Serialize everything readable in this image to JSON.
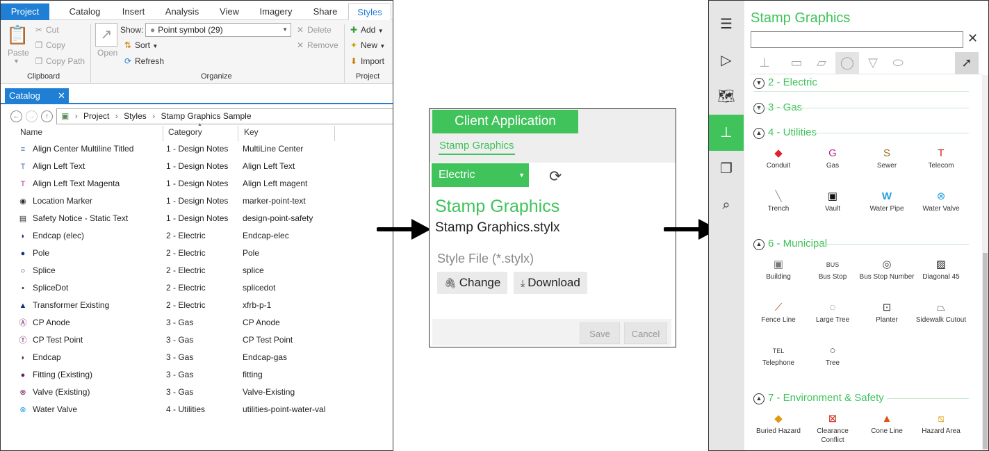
{
  "ribbon": {
    "tabs": [
      "Project",
      "Catalog",
      "Insert",
      "Analysis",
      "View",
      "Imagery",
      "Share",
      "Styles"
    ],
    "clipboard": {
      "paste": "Paste",
      "cut": "Cut",
      "copy": "Copy",
      "copy_path": "Copy Path",
      "label": "Clipboard"
    },
    "organize": {
      "open": "Open",
      "show_label": "Show:",
      "show_value": "Point symbol (29)",
      "sort": "Sort",
      "refresh": "Refresh",
      "delete": "Delete",
      "remove": "Remove",
      "label": "Organize"
    },
    "project": {
      "add": "Add",
      "new": "New",
      "import": "Import",
      "label": "Project"
    }
  },
  "catalog": {
    "tab_label": "Catalog",
    "breadcrumb": [
      "Project",
      "Styles",
      "Stamp Graphics Sample"
    ],
    "columns": [
      "Name",
      "Category",
      "Key"
    ],
    "rows": [
      {
        "icon": "multiline-text-icon",
        "name": "Align Center Multiline Titled",
        "category": "1 - Design Notes",
        "key": "MultiLine Center"
      },
      {
        "icon": "text-icon",
        "name": "Align Left Text",
        "category": "1 - Design Notes",
        "key": "Align Left Text"
      },
      {
        "icon": "text-magenta-icon",
        "name": "Align Left Text Magenta",
        "category": "1 - Design Notes",
        "key": "Align Left magent"
      },
      {
        "icon": "location-marker-icon",
        "name": "Location Marker",
        "category": "1 - Design Notes",
        "key": "marker-point-text"
      },
      {
        "icon": "safety-notice-icon",
        "name": "Safety Notice - Static Text",
        "category": "1 - Design Notes",
        "key": "design-point-safety"
      },
      {
        "icon": "endcap-icon",
        "name": "Endcap (elec)",
        "category": "2 - Electric",
        "key": "Endcap-elec"
      },
      {
        "icon": "pole-icon",
        "name": "Pole",
        "category": "2 - Electric",
        "key": "Pole"
      },
      {
        "icon": "splice-icon",
        "name": "Splice",
        "category": "2 - Electric",
        "key": "splice"
      },
      {
        "icon": "splicedot-icon",
        "name": "SpliceDot",
        "category": "2 - Electric",
        "key": "splicedot"
      },
      {
        "icon": "transformer-icon",
        "name": "Transformer Existing",
        "category": "2 - Electric",
        "key": "xfrb-p-1"
      },
      {
        "icon": "cp-anode-icon",
        "name": "CP Anode",
        "category": "3 - Gas",
        "key": "CP Anode"
      },
      {
        "icon": "cp-test-point-icon",
        "name": "CP Test Point",
        "category": "3 - Gas",
        "key": "CP Test Point"
      },
      {
        "icon": "endcap-gas-icon",
        "name": "Endcap",
        "category": "3 - Gas",
        "key": "Endcap-gas"
      },
      {
        "icon": "fitting-icon",
        "name": "Fitting (Existing)",
        "category": "3 - Gas",
        "key": "fitting"
      },
      {
        "icon": "valve-icon",
        "name": "Valve (Existing)",
        "category": "3 - Gas",
        "key": "Valve-Existing"
      },
      {
        "icon": "water-valve-icon",
        "name": "Water Valve",
        "category": "4 - Utilities",
        "key": "utilities-point-water-val"
      }
    ]
  },
  "client": {
    "header_button": "Client Application",
    "tab": "Stamp Graphics",
    "dropdown_value": "Electric",
    "title": "Stamp Graphics",
    "filename": "Stamp Graphics.stylx",
    "style_file_label": "Style File (*.stylx)",
    "change_label": "Change",
    "download_label": "Download",
    "save_label": "Save",
    "cancel_label": "Cancel"
  },
  "stamp_panel": {
    "title": "Stamp Graphics",
    "search_value": "",
    "sections": {
      "electric": "2 - Electric",
      "gas": "3 - Gas",
      "utilities": "4 - Utilities",
      "municipal": "6 - Municipal",
      "environment": "7 - Environment & Safety"
    },
    "utilities_items": [
      "Conduit",
      "Gas",
      "Sewer",
      "Telecom",
      "Trench",
      "Vault",
      "Water Pipe",
      "Water Valve"
    ],
    "municipal_items": [
      "Building",
      "Bus Stop",
      "Bus Stop Number",
      "Diagonal 45",
      "Fence Line",
      "Large Tree",
      "Planter",
      "Sidewalk Cutout",
      "Telephone",
      "Tree"
    ],
    "environment_items": [
      "Buried Hazard",
      "Clearance Conflict",
      "Cone Line",
      "Hazard Area"
    ]
  },
  "colors": {
    "accent_green": "#3fc35a",
    "accent_blue": "#1f7fd4"
  }
}
